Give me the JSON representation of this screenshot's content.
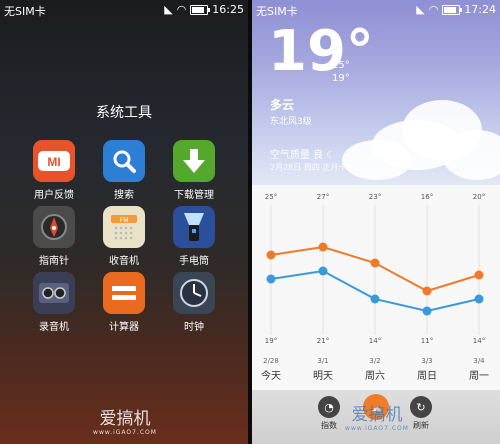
{
  "left_screen": {
    "status": {
      "carrier": "无SIM卡",
      "time": "16:25"
    },
    "folder_title": "系统工具",
    "apps": [
      {
        "label": "用户反馈",
        "icon": "mi-feedback-icon",
        "color": "#e8532a"
      },
      {
        "label": "搜索",
        "icon": "search-icon",
        "color": "#2d7fd6"
      },
      {
        "label": "下载管理",
        "icon": "download-icon",
        "color": "#54a82b"
      },
      {
        "label": "指南针",
        "icon": "compass-icon",
        "color": "#4b4b4b"
      },
      {
        "label": "收音机",
        "icon": "radio-icon",
        "color": "#e9e2c6"
      },
      {
        "label": "手电筒",
        "icon": "flashlight-icon",
        "color": "#2b4f9a"
      },
      {
        "label": "录音机",
        "icon": "recorder-icon",
        "color": "#3b3f55"
      },
      {
        "label": "计算器",
        "icon": "calculator-icon",
        "color": "#ea6a1f"
      },
      {
        "label": "时钟",
        "icon": "clock-icon",
        "color": "#3a4556"
      }
    ],
    "watermark": {
      "text": "爱搞机",
      "url": "www.iGAO7.COM"
    }
  },
  "right_screen": {
    "status": {
      "carrier": "无SIM卡",
      "time": "17:24"
    },
    "current": {
      "temp": "19°",
      "high": "25°",
      "low": "19°",
      "condition": "多云",
      "wind": "东北风3级",
      "air_quality": "空气质量 良",
      "date": "2月28日 周四 正月十九"
    },
    "chart_data": {
      "type": "line",
      "categories": [
        "今天",
        "明天",
        "周六",
        "周日",
        "周一"
      ],
      "dates": [
        "2/28",
        "3/1",
        "3/2",
        "3/3",
        "3/4"
      ],
      "series": [
        {
          "values": [
            25,
            27,
            23,
            16,
            20
          ],
          "labels": [
            "25°",
            "27°",
            "23°",
            "16°",
            "20°"
          ],
          "color": "#ee7a2a"
        },
        {
          "values": [
            19,
            21,
            14,
            11,
            14
          ],
          "labels": [
            "19°",
            "21°",
            "14°",
            "11°",
            "14°"
          ],
          "color": "#3a9ad9"
        }
      ]
    },
    "toolbar": {
      "index_label": "指数",
      "refresh_label": "刷新"
    },
    "watermark": {
      "text": "爱搞机",
      "url": "www.iGAO7.COM"
    }
  }
}
